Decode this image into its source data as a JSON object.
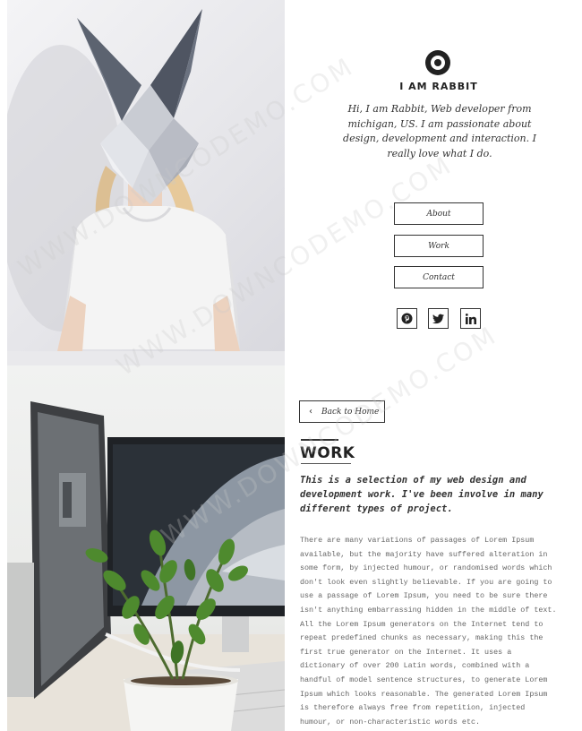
{
  "brand": {
    "name": "I AM RABBIT",
    "logo_icon": "ring-logo-icon"
  },
  "profile": {
    "bio": "Hi, I am Rabbit, Web developer from michigan, US. I am passionate about design, development and interaction. I really love what I do."
  },
  "nav": {
    "items": [
      {
        "label": "About"
      },
      {
        "label": "Work"
      },
      {
        "label": "Contact"
      }
    ]
  },
  "social": {
    "items": [
      {
        "icon": "pinterest-icon"
      },
      {
        "icon": "twitter-icon"
      },
      {
        "icon": "linkedin-icon"
      }
    ]
  },
  "work": {
    "back_label": "Back to Home",
    "title": "WORK",
    "lead": "This is a selection of my web design and development work. I've been involve in many different types of project.",
    "body": "There are many variations of passages of Lorem Ipsum available, but the majority have suffered alteration in some form, by injected humour, or randomised words which don't look even slightly believable. If you are going to use a passage of Lorem Ipsum, you need to be sure there isn't anything embarrassing hidden in the middle of text. All the Lorem Ipsum generators on the Internet tend to repeat predefined chunks as necessary, making this the first true generator on the Internet. It uses a dictionary of over 200 Latin words, combined with a handful of model sentence structures, to generate Lorem Ipsum which looks reasonable. The generated Lorem Ipsum is therefore always free from repetition, injected humour, or non-characteristic words etc."
  },
  "watermark": {
    "text": "WWW.DOWNCODEMO.COM"
  },
  "colors": {
    "text": "#333333",
    "border": "#333333",
    "background": "#ffffff"
  }
}
